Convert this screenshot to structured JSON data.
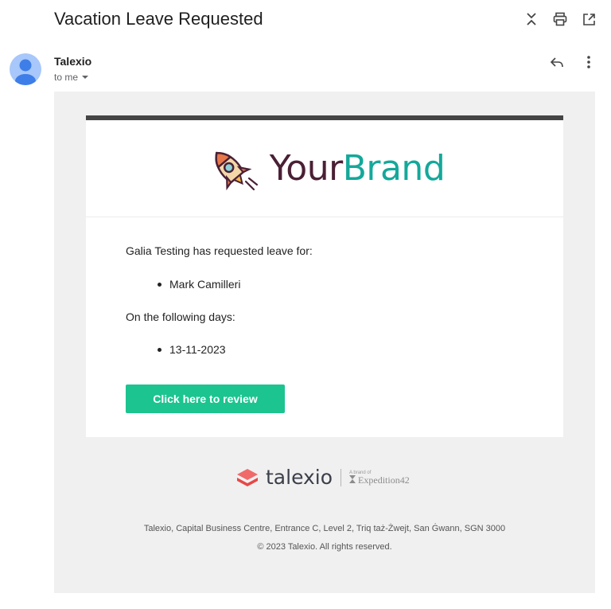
{
  "header": {
    "subject": "Vacation Leave Requested",
    "icons": [
      "collapse-icon",
      "print-icon",
      "open-in-new-icon"
    ]
  },
  "message": {
    "sender": "Talexio",
    "recipient": "to me",
    "icons": [
      "reply-icon",
      "more-vert-icon"
    ]
  },
  "email": {
    "brand": {
      "part1": "Your",
      "part2": "Brand"
    },
    "intro": "Galia Testing has requested leave for:",
    "employees": [
      "Mark Camilleri"
    ],
    "days_label": "On the following days:",
    "days": [
      "13-11-2023"
    ],
    "cta_label": "Click here to review",
    "footer": {
      "logo_word": "talexio",
      "brand_of": "A brand of",
      "partner": "Expedition42",
      "address": "Talexio, Capital Business Centre, Entrance C, Level 2, Triq taż-Żwejt, San Ġwann, SGN 3000",
      "copyright": "© 2023 Talexio. All rights reserved."
    }
  },
  "colors": {
    "accent": "#1cc48f",
    "brand_dark": "#4a2035",
    "brand_teal": "#14a89a",
    "frame_bg": "#f0f0f0",
    "card_top_border": "#444444"
  }
}
